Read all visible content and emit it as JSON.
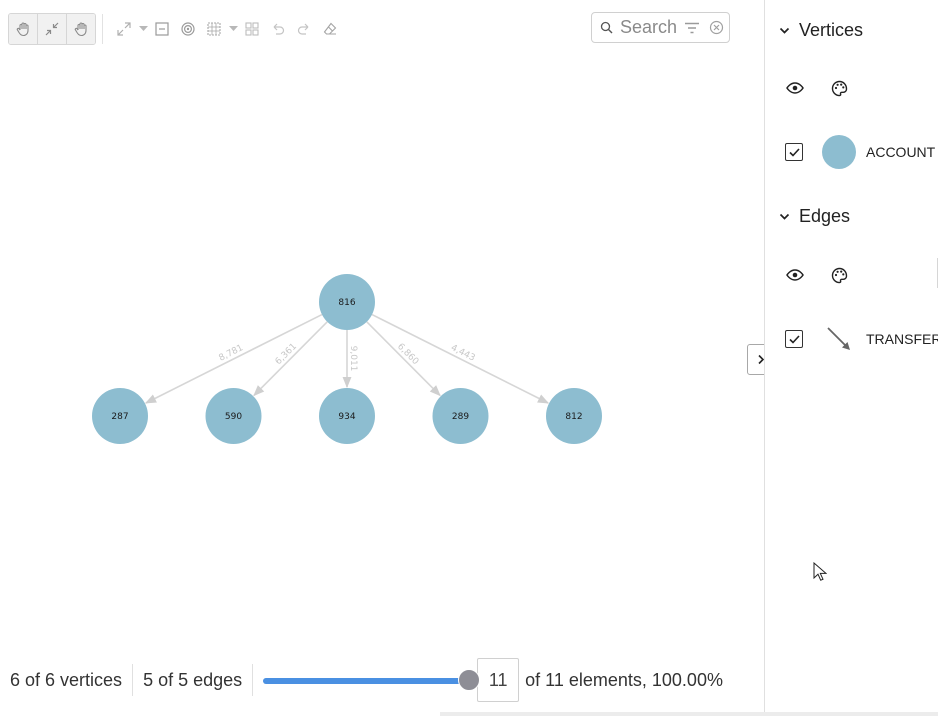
{
  "toolbar": {
    "buttons": [
      "pan-icon",
      "collapse-icon",
      "grab-icon"
    ],
    "tools": [
      "fit-icon",
      "minus-box-icon",
      "target-icon",
      "grid-icon",
      "group-icon",
      "undo-icon",
      "redo-icon",
      "eraser-icon"
    ]
  },
  "search": {
    "placeholder": "Search",
    "value": ""
  },
  "graph": {
    "vertices": [
      {
        "id": "816"
      },
      {
        "id": "287"
      },
      {
        "id": "590"
      },
      {
        "id": "934"
      },
      {
        "id": "289"
      },
      {
        "id": "812"
      }
    ],
    "edges": [
      {
        "source": "816",
        "target": "287",
        "label": "8,781"
      },
      {
        "source": "816",
        "target": "590",
        "label": "6,361"
      },
      {
        "source": "816",
        "target": "934",
        "label": "9,011"
      },
      {
        "source": "816",
        "target": "289",
        "label": "6,860"
      },
      {
        "source": "816",
        "target": "812",
        "label": "4,443"
      }
    ],
    "node_color": "#8dbdd0",
    "edge_color": "#d6d6d6"
  },
  "status": {
    "vertices_text": "6 of 6 vertices",
    "edges_text": "5 of 5 edges",
    "slider_fraction": 1.0,
    "element_count": "11",
    "elements_text": "of 11 elements, 100.00%"
  },
  "panel": {
    "vertices": {
      "title": "Vertices",
      "items": [
        {
          "label": "ACCOUNT",
          "color": "#8dbdd0",
          "checked": true
        }
      ]
    },
    "edges": {
      "title": "Edges",
      "items": [
        {
          "label": "TRANSFER",
          "checked": true
        }
      ]
    }
  },
  "colors": {
    "accent": "#4a90e2",
    "thumb": "#8e8e96"
  }
}
